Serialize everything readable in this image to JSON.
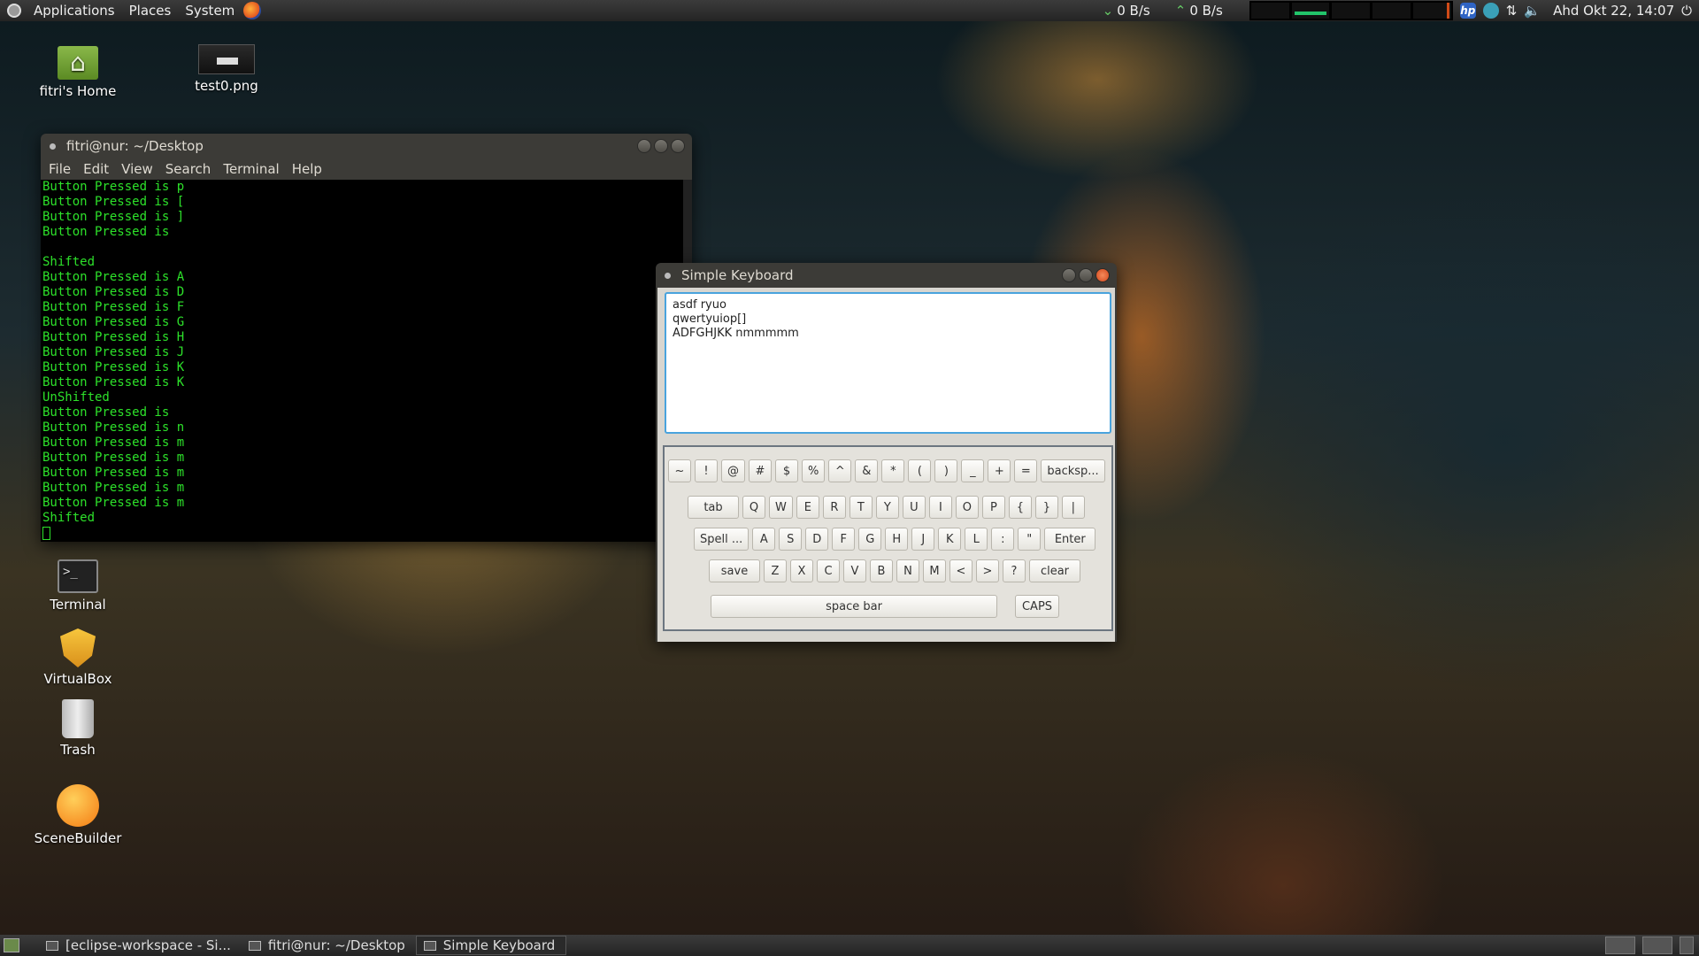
{
  "top_panel": {
    "menus": [
      "Applications",
      "Places",
      "System"
    ],
    "net_down": "0 B/s",
    "net_up": "0 B/s",
    "clock": "Ahd Okt 22, 14:07"
  },
  "desktop_icons": {
    "home": "fitri's Home",
    "image": "test0.png",
    "terminal": "Terminal",
    "virtualbox": "VirtualBox",
    "trash": "Trash",
    "scenebuilder": "SceneBuilder"
  },
  "terminal_window": {
    "title": "fitri@nur: ~/Desktop",
    "menus": [
      "File",
      "Edit",
      "View",
      "Search",
      "Terminal",
      "Help"
    ],
    "lines": [
      "Button Pressed is p",
      "Button Pressed is [",
      "Button Pressed is ]",
      "Button Pressed is",
      "",
      "Shifted",
      "Button Pressed is A",
      "Button Pressed is D",
      "Button Pressed is F",
      "Button Pressed is G",
      "Button Pressed is H",
      "Button Pressed is J",
      "Button Pressed is K",
      "Button Pressed is K",
      "UnShifted",
      "Button Pressed is",
      "Button Pressed is n",
      "Button Pressed is m",
      "Button Pressed is m",
      "Button Pressed is m",
      "Button Pressed is m",
      "Button Pressed is m",
      "Shifted"
    ]
  },
  "keyboard_window": {
    "title": "Simple Keyboard",
    "text_lines": [
      "asdf ryuo",
      "qwertyuiop[]",
      "ADFGHJKK nmmmmm"
    ],
    "rows": [
      [
        "~",
        "!",
        "@",
        "#",
        "$",
        "%",
        "^",
        "&",
        "*",
        "(",
        ")",
        "_",
        "+",
        "=",
        "backsp..."
      ],
      [
        "tab",
        "Q",
        "W",
        "E",
        "R",
        "T",
        "Y",
        "U",
        "I",
        "O",
        "P",
        "{",
        "}",
        "|"
      ],
      [
        "Spell ...",
        "A",
        "S",
        "D",
        "F",
        "G",
        "H",
        "J",
        "K",
        "L",
        ":",
        "\"",
        "Enter"
      ],
      [
        "save",
        "Z",
        "X",
        "C",
        "V",
        "B",
        "N",
        "M",
        "<",
        ">",
        "?",
        "clear"
      ]
    ],
    "space_label": "space bar",
    "caps_label": "CAPS"
  },
  "taskbar": {
    "items": [
      "[eclipse-workspace - Si...",
      "fitri@nur: ~/Desktop",
      "Simple Keyboard"
    ]
  }
}
